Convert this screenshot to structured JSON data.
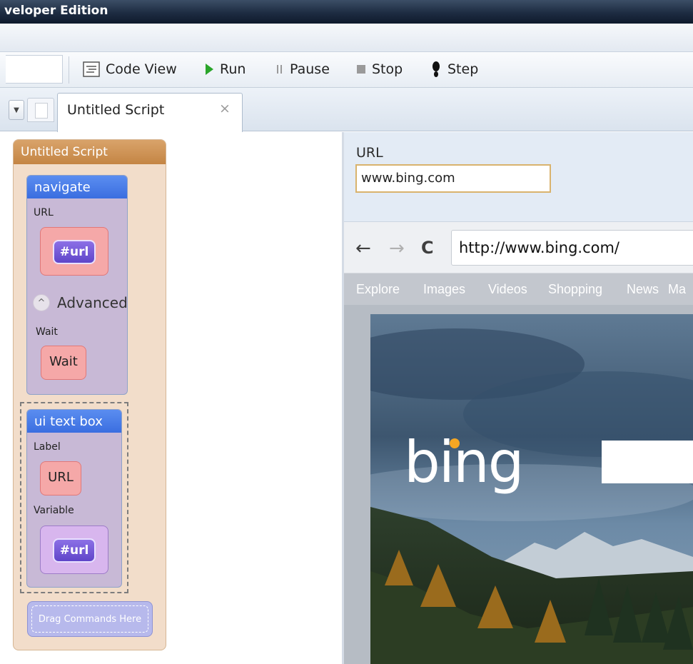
{
  "window": {
    "title": "veloper Edition"
  },
  "toolbar": {
    "code_view": "Code View",
    "run": "Run",
    "pause": "Pause",
    "stop": "Stop",
    "step": "Step"
  },
  "tabs": [
    {
      "label": "Untitled Script",
      "close": "×"
    }
  ],
  "script": {
    "title": "Untitled Script",
    "navigate": {
      "title": "navigate",
      "url_label": "URL",
      "url_var": "#url",
      "advanced": "Advanced",
      "advanced_icon": "^",
      "wait_label": "Wait",
      "wait_value": "Wait"
    },
    "ui_text_box": {
      "title": "ui text box",
      "label_label": "Label",
      "label_value": "URL",
      "variable_label": "Variable",
      "variable_value": "#url"
    },
    "drag_here": "Drag Commands Here"
  },
  "preview": {
    "url_label": "URL",
    "url_value": "www.bing.com"
  },
  "browser": {
    "back": "←",
    "forward": "→",
    "reload": "C",
    "address": "http://www.bing.com/",
    "nav": [
      "Explore",
      "Images",
      "Videos",
      "Shopping",
      "News",
      "Ma"
    ],
    "logo": "bing"
  },
  "colors": {
    "accent_green": "#2aa52a",
    "command_blue": "#3a6ee0",
    "script_header": "#c48544",
    "var_purple": "#5f45c9"
  }
}
